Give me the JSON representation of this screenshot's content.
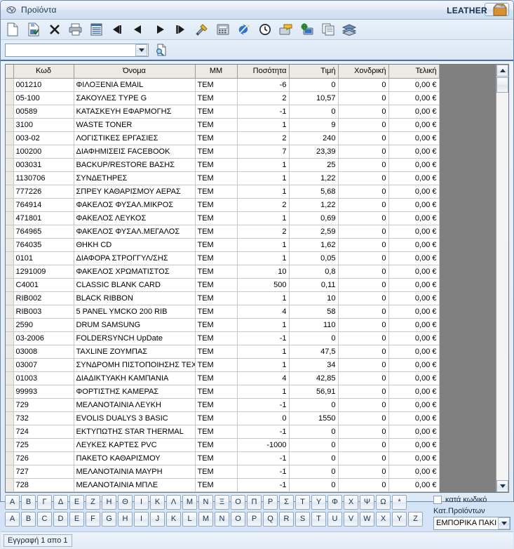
{
  "window": {
    "title": "Προϊόντα",
    "system_icon": "app-icon",
    "close_label": "✕"
  },
  "toolbar": {
    "items": [
      {
        "name": "new-icon",
        "title": "Νέο"
      },
      {
        "name": "save-icon",
        "title": "Αποθήκευση"
      },
      {
        "name": "delete-icon",
        "title": "Διαγραφή"
      },
      {
        "name": "print-icon",
        "title": "Εκτύπωση"
      },
      {
        "name": "grid-icon",
        "title": "Λίστα"
      },
      {
        "name": "first-record-icon",
        "title": "Πρώτη"
      },
      {
        "name": "previous-record-icon",
        "title": "Προηγούμενη"
      },
      {
        "name": "next-record-icon",
        "title": "Επόμενη"
      },
      {
        "name": "last-record-icon",
        "title": "Τελευταία"
      },
      {
        "name": "tools-icon",
        "title": "Εργαλεία"
      },
      {
        "name": "calculator-icon",
        "title": "Αριθμομηχανή"
      },
      {
        "name": "refresh-icon",
        "title": "Ανανέωση"
      },
      {
        "name": "clock-icon",
        "title": "Ιστορικό"
      },
      {
        "name": "mail-icon",
        "title": "Αποστολή"
      },
      {
        "name": "network-icon",
        "title": "Δίκτυο"
      },
      {
        "name": "copy-icon",
        "title": "Αντιγραφή"
      },
      {
        "name": "layers-icon",
        "title": "Επίπεδα"
      }
    ]
  },
  "search": {
    "value": "",
    "placeholder": "",
    "dropdown_icon": "chevron-down-icon",
    "find_icon": "find-document-icon"
  },
  "brand": {
    "label": "LEATHER",
    "icon": "package-box-icon"
  },
  "grid": {
    "columns": [
      {
        "key": "sel",
        "label": ""
      },
      {
        "key": "kwd",
        "label": "Κωδ"
      },
      {
        "key": "name",
        "label": "Όνομα"
      },
      {
        "key": "mm",
        "label": "ΜΜ"
      },
      {
        "key": "qty",
        "label": "Ποσότητα"
      },
      {
        "key": "price",
        "label": "Τιμή"
      },
      {
        "key": "wholesale",
        "label": "Χονδρική"
      },
      {
        "key": "final",
        "label": "Τελική"
      }
    ],
    "rows": [
      {
        "kwd": "001210",
        "name": "ΦΙΛΟΞΕΝΙΑ EMAIL",
        "mm": "ΤΕΜ",
        "qty": "-6",
        "price": "0",
        "wholesale": "0",
        "final": "0,00 €"
      },
      {
        "kwd": "05-100",
        "name": "ΣΑΚΟΥΛΕΣ TYPE G",
        "mm": "ΤΕΜ",
        "qty": "2",
        "price": "10,57",
        "wholesale": "0",
        "final": "0,00 €"
      },
      {
        "kwd": "00589",
        "name": "ΚΑΤΑΣΚΕΥΗ ΕΦΑΡΜΟΓΗΣ",
        "mm": "ΤΕΜ",
        "qty": "-1",
        "price": "0",
        "wholesale": "0",
        "final": "0,00 €"
      },
      {
        "kwd": "3100",
        "name": "WASTE TONER",
        "mm": "ΤΕΜ",
        "qty": "1",
        "price": "9",
        "wholesale": "0",
        "final": "0,00 €"
      },
      {
        "kwd": "003-02",
        "name": "ΛΟΓΙΣΤΙΚΕΣ ΕΡΓΑΣΙΕΣ",
        "mm": "ΤΕΜ",
        "qty": "2",
        "price": "240",
        "wholesale": "0",
        "final": "0,00 €"
      },
      {
        "kwd": "100200",
        "name": "ΔΙΑΦΗΜΙΣΕΙΣ FACEBOOK",
        "mm": "ΤΕΜ",
        "qty": "7",
        "price": "23,39",
        "wholesale": "0",
        "final": "0,00 €"
      },
      {
        "kwd": "003031",
        "name": "BACKUP/RESTORE ΒΑΣΗΣ",
        "mm": "ΤΕΜ",
        "qty": "1",
        "price": "25",
        "wholesale": "0",
        "final": "0,00 €"
      },
      {
        "kwd": "1130706",
        "name": "ΣΥΝΔΕΤΗΡΕΣ",
        "mm": "ΤΕΜ",
        "qty": "1",
        "price": "1,22",
        "wholesale": "0",
        "final": "0,00 €"
      },
      {
        "kwd": "777226",
        "name": "ΣΠΡΕΥ ΚΑΘΑΡΙΣΜΟΥ ΑΕΡΑΣ",
        "mm": "ΤΕΜ",
        "qty": "1",
        "price": "5,68",
        "wholesale": "0",
        "final": "0,00 €"
      },
      {
        "kwd": "764914",
        "name": "ΦΑΚΕΛΟΣ ΦΥΣΑΛ.ΜΙΚΡΟΣ",
        "mm": "ΤΕΜ",
        "qty": "2",
        "price": "1,22",
        "wholesale": "0",
        "final": "0,00 €"
      },
      {
        "kwd": "471801",
        "name": "ΦΑΚΕΛΟΣ ΛΕΥΚΟΣ",
        "mm": "ΤΕΜ",
        "qty": "1",
        "price": "0,69",
        "wholesale": "0",
        "final": "0,00 €"
      },
      {
        "kwd": "764965",
        "name": "ΦΑΚΕΛΟΣ ΦΥΣΑΛ.ΜΕΓΑΛΟΣ",
        "mm": "ΤΕΜ",
        "qty": "2",
        "price": "2,59",
        "wholesale": "0",
        "final": "0,00 €"
      },
      {
        "kwd": "764035",
        "name": "ΘΗΚΗ CD",
        "mm": "ΤΕΜ",
        "qty": "1",
        "price": "1,62",
        "wholesale": "0",
        "final": "0,00 €"
      },
      {
        "kwd": "0101",
        "name": "ΔΙΑΦΟΡΑ ΣΤΡΟΓΓΥΛ/ΣΗΣ",
        "mm": "ΤΕΜ",
        "qty": "1",
        "price": "0,05",
        "wholesale": "0",
        "final": "0,00 €"
      },
      {
        "kwd": "1291009",
        "name": "ΦΑΚΕΛΟΣ ΧΡΩΜΑΤΙΣΤΟΣ",
        "mm": "ΤΕΜ",
        "qty": "10",
        "price": "0,8",
        "wholesale": "0",
        "final": "0,00 €"
      },
      {
        "kwd": "C4001",
        "name": "CLASSIC BLANK CARD",
        "mm": "ΤΕΜ",
        "qty": "500",
        "price": "0,11",
        "wholesale": "0",
        "final": "0,00 €"
      },
      {
        "kwd": "RIB002",
        "name": "BLACK RIBBON",
        "mm": "ΤΕΜ",
        "qty": "1",
        "price": "10",
        "wholesale": "0",
        "final": "0,00 €"
      },
      {
        "kwd": "RIB003",
        "name": "5 PANEL YMCKO 200 RIB",
        "mm": "ΤΕΜ",
        "qty": "4",
        "price": "58",
        "wholesale": "0",
        "final": "0,00 €"
      },
      {
        "kwd": "2590",
        "name": "DRUM SAMSUNG",
        "mm": "ΤΕΜ",
        "qty": "1",
        "price": "110",
        "wholesale": "0",
        "final": "0,00 €"
      },
      {
        "kwd": "03-2006",
        "name": "FOLDERSYNCH UpDate",
        "mm": "ΤΕΜ",
        "qty": "-1",
        "price": "0",
        "wholesale": "0",
        "final": "0,00 €"
      },
      {
        "kwd": "03008",
        "name": "TAXLINE ΖΟΥΜΠΑΣ",
        "mm": "ΤΕΜ",
        "qty": "1",
        "price": "47,5",
        "wholesale": "0",
        "final": "0,00 €"
      },
      {
        "kwd": "03007",
        "name": "ΣΥΝΔΡΟΜΗ ΠΙΣΤΟΠΟΙΗΣΗΣ ΤΕΧΝΙΙ",
        "mm": "ΤΕΜ",
        "qty": "1",
        "price": "34",
        "wholesale": "0",
        "final": "0,00 €"
      },
      {
        "kwd": "01003",
        "name": "ΔΙΑΔΙΚΤΥΑΚΗ ΚΑΜΠΑΝΙΑ",
        "mm": "ΤΕΜ",
        "qty": "4",
        "price": "42,85",
        "wholesale": "0",
        "final": "0,00 €"
      },
      {
        "kwd": "99993",
        "name": "ΦΟΡΤΙΣΤΗΣ ΚΑΜΕΡΑΣ",
        "mm": "ΤΕΜ",
        "qty": "1",
        "price": "56,91",
        "wholesale": "0",
        "final": "0,00 €"
      },
      {
        "kwd": "729",
        "name": "ΜΕΛΑΝΟΤΑΙΝΙΑ ΛΕΥΚΗ",
        "mm": "ΤΕΜ",
        "qty": "-1",
        "price": "0",
        "wholesale": "0",
        "final": "0,00 €"
      },
      {
        "kwd": "732",
        "name": "EVOLIS DUALYS 3 BASIC",
        "mm": "ΤΕΜ",
        "qty": "0",
        "price": "1550",
        "wholesale": "0",
        "final": "0,00 €"
      },
      {
        "kwd": "724",
        "name": "ΕΚΤΥΠΩΤΗΣ STAR THERMAL",
        "mm": "ΤΕΜ",
        "qty": "-1",
        "price": "0",
        "wholesale": "0",
        "final": "0,00 €"
      },
      {
        "kwd": "725",
        "name": "ΛΕΥΚΕΣ ΚΑΡΤΕΣ PVC",
        "mm": "ΤΕΜ",
        "qty": "-1000",
        "price": "0",
        "wholesale": "0",
        "final": "0,00 €"
      },
      {
        "kwd": "726",
        "name": "ΠΑΚΕΤΟ ΚΑΘΑΡΙΣΜΟΥ",
        "mm": "ΤΕΜ",
        "qty": "-1",
        "price": "0",
        "wholesale": "0",
        "final": "0,00 €"
      },
      {
        "kwd": "727",
        "name": "ΜΕΛΑΝΟΤΑΙΝΙΑ ΜΑΥΡΗ",
        "mm": "ΤΕΜ",
        "qty": "-1",
        "price": "0",
        "wholesale": "0",
        "final": "0,00 €"
      },
      {
        "kwd": "728",
        "name": "ΜΕΛΑΝΟΤΑΙΝΙΑ ΜΠΛΕ",
        "mm": "ΤΕΜ",
        "qty": "-1",
        "price": "0",
        "wholesale": "0",
        "final": "0,00 €"
      }
    ]
  },
  "alpha": {
    "greek": [
      "Α",
      "Β",
      "Γ",
      "Δ",
      "Ε",
      "Ζ",
      "Η",
      "Θ",
      "Ι",
      "Κ",
      "Λ",
      "Μ",
      "Ν",
      "Ξ",
      "Ο",
      "Π",
      "Ρ",
      "Σ",
      "Τ",
      "Υ",
      "Φ",
      "Χ",
      "Ψ",
      "Ω",
      "*"
    ],
    "latin": [
      "A",
      "B",
      "C",
      "D",
      "E",
      "F",
      "G",
      "H",
      "I",
      "J",
      "K",
      "L",
      "M",
      "N",
      "O",
      "P",
      "Q",
      "R",
      "S",
      "T",
      "U",
      "V",
      "W",
      "X",
      "Y",
      "Z"
    ]
  },
  "filters": {
    "by_code_label": "κατά κωδικό",
    "by_code_checked": false,
    "category_label": "Κατ.Προϊόντων",
    "category_value": "ΕΜΠΟΡΙΚΑ ΠΑΚΙ"
  },
  "status": {
    "record_text": "Εγγραφή 1 απο 1"
  },
  "colors": {
    "accent": "#4a6fa5",
    "grid_empty": "#808080",
    "header_bg": "#eceae3"
  }
}
